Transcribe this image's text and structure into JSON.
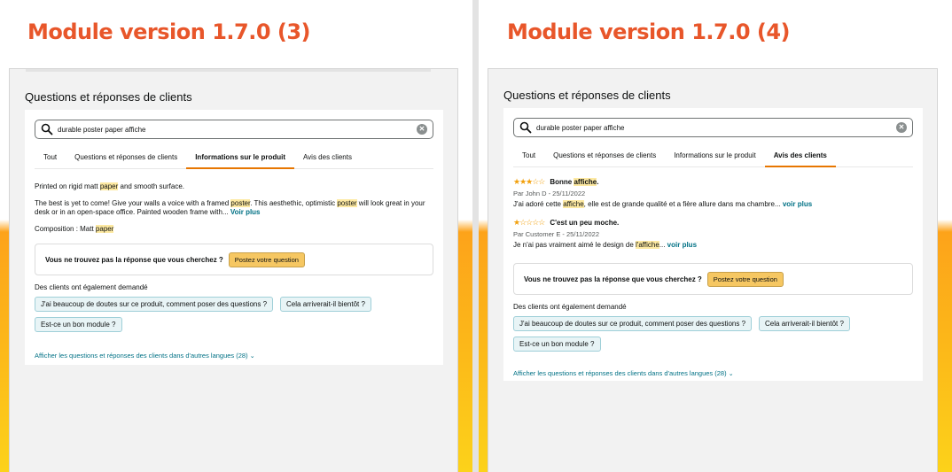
{
  "left": {
    "heading": "Module version 1.7.0 (3)",
    "section_title": "Questions et réponses de clients",
    "search": {
      "value": "durable poster paper affiche",
      "clear_glyph": "✕"
    },
    "tabs": [
      "Tout",
      "Questions et réponses de clients",
      "Informations sur le produit",
      "Avis des clients"
    ],
    "active_tab": 2,
    "product_info": {
      "p1": [
        "Printed on rigid matt ",
        "paper",
        " and smooth surface."
      ],
      "p2": [
        "The best is yet to come! Give your walls a voice with a framed ",
        "poster",
        ". This aesthethic, optimistic ",
        "poster",
        " will look great in your desk or in an open-space office. Painted wooden frame with... "
      ],
      "p2_link": "Voir plus",
      "p3": [
        "Composition : Matt ",
        "paper"
      ]
    },
    "ask": {
      "text": "Vous ne trouvez pas la réponse que vous cherchez ?",
      "button": "Postez votre question"
    },
    "also_label": "Des clients ont également demandé",
    "also_questions": [
      "J'ai beaucoup de doutes sur ce produit, comment poser des questions ?",
      "Cela arriverait-il bientôt ?",
      "Est-ce un bon module ?"
    ],
    "more_link": "Afficher les questions et réponses des clients dans d'autres langues (28)"
  },
  "right": {
    "heading": "Module version 1.7.0 (4)",
    "section_title": "Questions et réponses de clients",
    "search": {
      "value": "durable poster paper affiche",
      "clear_glyph": "✕"
    },
    "tabs": [
      "Tout",
      "Questions et réponses de clients",
      "Informations sur le produit",
      "Avis des clients"
    ],
    "active_tab": 3,
    "reviews": [
      {
        "rating": 3,
        "title_pre": "Bonne ",
        "title_hl": "affiche",
        "title_post": ".",
        "meta": "Par John D - 25/11/2022",
        "text_pre": "J'ai adoré cette ",
        "text_hl": "affiche",
        "text_post": ", elle est de grande qualité et a fière allure dans ma chambre... ",
        "link": "voir plus"
      },
      {
        "rating": 1,
        "title_pre": "C'est un peu moche.",
        "title_hl": "",
        "title_post": "",
        "meta": "Par Customer E - 25/11/2022",
        "text_pre": "Je n'ai pas vraiment aimé le design de ",
        "text_hl": "l'affiche",
        "text_post": "... ",
        "link": "voir plus"
      }
    ],
    "ask": {
      "text": "Vous ne trouvez pas la réponse que vous cherchez ?",
      "button": "Postez votre question"
    },
    "also_label": "Des clients ont également demandé",
    "also_questions": [
      "J'ai beaucoup de doutes sur ce produit, comment poser des questions ?",
      "Cela arriverait-il bientôt ?",
      "Est-ce un bon module ?"
    ],
    "more_link": "Afficher les questions et réponses des clients dans d'autres langues (28)"
  },
  "colors": {
    "heading": "#e8562a",
    "active_tab_underline": "#e77600",
    "link": "#007185",
    "highlight": "#fde9a2",
    "button": "#f6c762",
    "star": "#f2a00c"
  }
}
